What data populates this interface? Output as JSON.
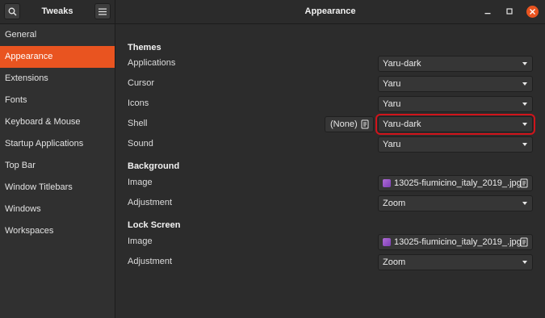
{
  "header": {
    "app_title": "Tweaks",
    "window_title": "Appearance"
  },
  "sidebar": {
    "items": [
      {
        "label": "General"
      },
      {
        "label": "Appearance",
        "active": true
      },
      {
        "label": "Extensions"
      },
      {
        "label": "Fonts"
      },
      {
        "label": "Keyboard & Mouse"
      },
      {
        "label": "Startup Applications"
      },
      {
        "label": "Top Bar"
      },
      {
        "label": "Window Titlebars"
      },
      {
        "label": "Windows"
      },
      {
        "label": "Workspaces"
      }
    ]
  },
  "themes": {
    "title": "Themes",
    "applications": {
      "label": "Applications",
      "value": "Yaru-dark"
    },
    "cursor": {
      "label": "Cursor",
      "value": "Yaru"
    },
    "icons": {
      "label": "Icons",
      "value": "Yaru"
    },
    "shell": {
      "label": "Shell",
      "value": "Yaru-dark",
      "reset_label": "(None)"
    },
    "sound": {
      "label": "Sound",
      "value": "Yaru"
    }
  },
  "background": {
    "title": "Background",
    "image": {
      "label": "Image",
      "value": "13025-fiumicino_italy_2019_.jpg"
    },
    "adjustment": {
      "label": "Adjustment",
      "value": "Zoom"
    }
  },
  "lock_screen": {
    "title": "Lock Screen",
    "image": {
      "label": "Image",
      "value": "13025-fiumicino_italy_2019_.jpg"
    },
    "adjustment": {
      "label": "Adjustment",
      "value": "Zoom"
    }
  },
  "colors": {
    "accent": "#e95420",
    "highlight_outline": "#d1141b",
    "background": "#2c2c2c"
  }
}
